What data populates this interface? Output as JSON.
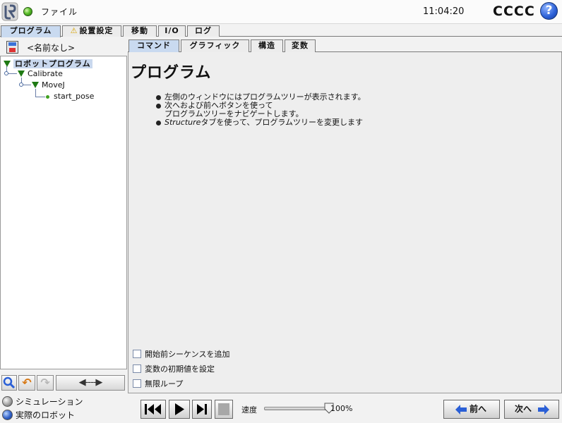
{
  "header": {
    "file_menu": "ファイル",
    "clock": "11:04:20",
    "robot_name": "CCCC",
    "help": "?"
  },
  "main_tabs": [
    {
      "label": "プログラム",
      "active": true
    },
    {
      "label": "設置設定",
      "warning": true
    },
    {
      "label": "移動"
    },
    {
      "label": "I/O"
    },
    {
      "label": "ログ"
    }
  ],
  "program": {
    "name": "<名前なし>"
  },
  "tree": {
    "root": "ロボットプログラム",
    "calibrate": "Calibrate",
    "movej": "MoveJ",
    "start_pose": "start_pose"
  },
  "tree_toolbar": {
    "move_arrow": "◀----▶"
  },
  "sub_tabs": [
    {
      "label": "コマンド",
      "active": true
    },
    {
      "label": "グラフィック"
    },
    {
      "label": "構造"
    },
    {
      "label": "変数"
    }
  ],
  "content": {
    "title": "プログラム",
    "help_line1": "左側のウィンドウにはプログラムツリーが表示されます。",
    "help_line2": "次へおよび前へボタンを使って",
    "help_line3": "プログラムツリーをナビゲートします。",
    "help_line4_italic": "Structure",
    "help_line4_rest": "タブを使って、プログラムツリーを変更します"
  },
  "options": {
    "add_before_start": "開始前シーケンスを追加",
    "set_initial_values": "変数の初期値を設定",
    "loop_forever": "無限ループ"
  },
  "footer": {
    "mode_simulation": "シミュレーション",
    "mode_real": "実際のロボット",
    "speed_label": "速度",
    "speed_value": "100%",
    "speed_fraction": 1.0,
    "back_label": "前へ",
    "next_label": "次へ"
  },
  "colors": {
    "accent": "#c9daf0",
    "tree_triangle": "#1f7a14",
    "waypoint": "#40a020",
    "nav_arrow": "#2a5fd6"
  }
}
